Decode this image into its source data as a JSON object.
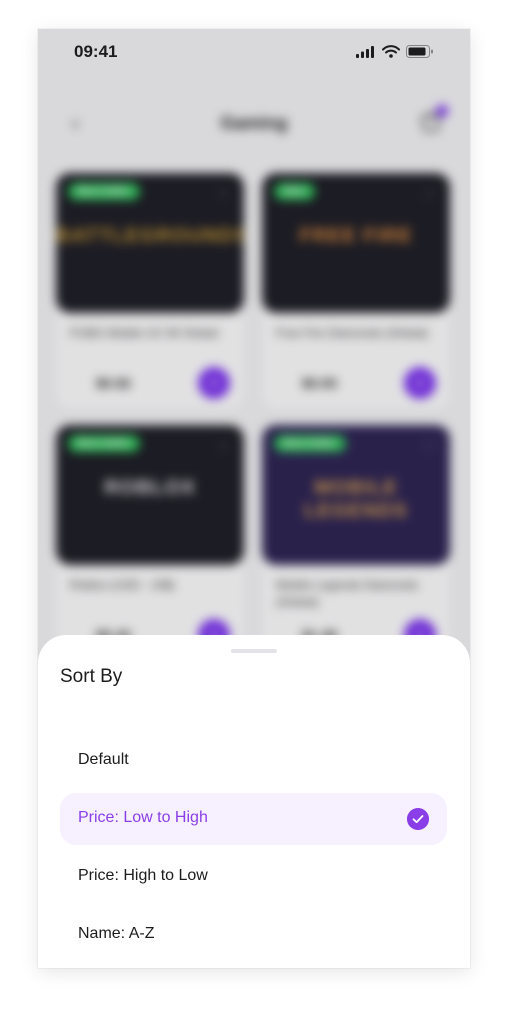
{
  "status_bar": {
    "time": "09:41",
    "icons": [
      "signal-icon",
      "wifi-icon",
      "battery-icon"
    ]
  },
  "header": {
    "title": "Gaming",
    "back_icon": "chevron-left-icon",
    "cart_icon": "cart-icon"
  },
  "products": [
    {
      "tag": "Best Seller",
      "logo": "BATTLEGROUNDS",
      "logo_color": "#c7962f",
      "name": "PUBG Mobile UC 60 Global",
      "price": "$0.92"
    },
    {
      "tag": "New",
      "logo": "FREE FIRE",
      "logo_color": "#e08a3a",
      "name": "Free Fire Diamonds (Global)",
      "price": "$0.93"
    },
    {
      "tag": "Best Seller",
      "logo": "ROBLOX",
      "logo_color": "#e6e6e6",
      "name": "Roblox (USD - 10$)",
      "price": "$5.20"
    },
    {
      "tag": "Best Seller",
      "logo": "MOBILE LEGENDS",
      "logo_color": "#d7a04c",
      "name": "Mobile Legends Diamonds (Global)",
      "price": "$1.49"
    }
  ],
  "sort_sheet": {
    "title": "Sort By",
    "options": [
      {
        "label": "Default",
        "selected": false
      },
      {
        "label": "Price: Low to High",
        "selected": true
      },
      {
        "label": "Price: High to Low",
        "selected": false
      },
      {
        "label": "Name: A-Z",
        "selected": false
      }
    ],
    "accent_color": "#8a3ee8",
    "selected_bg": "#f7f0ff"
  }
}
